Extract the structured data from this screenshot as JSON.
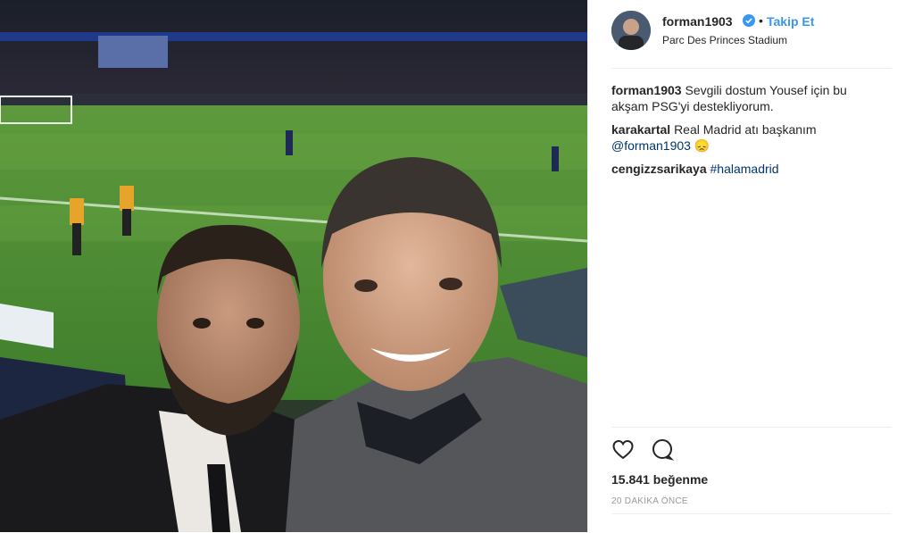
{
  "post": {
    "username": "forman1903",
    "separator": "•",
    "follow_label": "Takip Et",
    "location": "Parc Des Princes Stadium"
  },
  "comments": [
    {
      "user": "forman1903",
      "text": "Sevgili dostum Yousef için bu akşam PSG'yi destekliyorum."
    },
    {
      "user": "karakartal",
      "text": "Real Madrid atı başkanım",
      "mention": "@forman1903",
      "emoji": "😞"
    },
    {
      "user": "cengizzsarikaya",
      "hashtag": "#halamadrid"
    }
  ],
  "stats": {
    "likes": "15.841 beğenme",
    "time": "20 DAKİKA ÖNCE"
  },
  "colors": {
    "accent": "#3897f0",
    "link": "#003569",
    "muted": "#999999",
    "divider": "#efefef"
  }
}
